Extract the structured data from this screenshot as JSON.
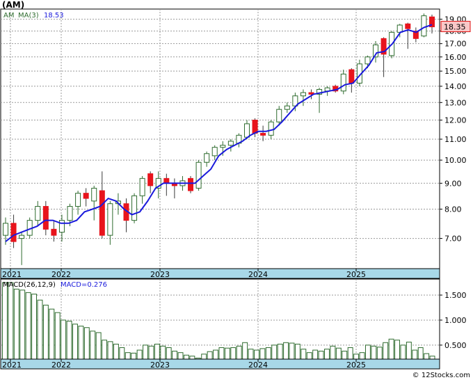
{
  "title": "(AM)",
  "price_legend": {
    "ma_label": "MA(3)",
    "ma_value": "18.53",
    "symbol": "AM"
  },
  "current_price_label": "18.35",
  "macd_legend": {
    "params": "MACD(26,12,9)",
    "value_label": "MACD=0.276"
  },
  "watermark": "© 12Stocks.com",
  "colors": {
    "up_candle": "#2e6b2e",
    "down_candle": "#e8141c",
    "ma_line": "#1a1adc",
    "macd_bar": "#2e6b2e",
    "axis_band": "#a8d8e8",
    "price_tag_bg": "#f9c8c8",
    "price_tag_text": "#e01010"
  },
  "chart_data": [
    {
      "type": "candlestick",
      "title": "(AM)",
      "x_tick_labels": [
        "2021",
        "2022",
        "2023",
        "2024",
        "2025"
      ],
      "y_tick_labels": [
        "7.00",
        "8.00",
        "9.00",
        "10.00",
        "11.00",
        "12.00",
        "13.00",
        "14.00",
        "15.00",
        "16.00",
        "17.00",
        "18.00",
        "19.00"
      ],
      "ylim": [
        6.1,
        19.9
      ],
      "y_scale": "log",
      "grid": true,
      "series": [
        {
          "name": "AM",
          "ohlc": [
            [
              7.1,
              7.7,
              6.8,
              7.5
            ],
            [
              7.5,
              7.8,
              6.7,
              6.9
            ],
            [
              7.0,
              7.2,
              6.2,
              7.1
            ],
            [
              7.1,
              7.7,
              7.0,
              7.6
            ],
            [
              7.6,
              8.3,
              7.4,
              8.1
            ],
            [
              8.1,
              8.3,
              7.1,
              7.3
            ],
            [
              7.3,
              7.6,
              6.9,
              7.1
            ],
            [
              7.2,
              7.8,
              6.9,
              7.6
            ],
            [
              7.6,
              8.2,
              7.4,
              8.1
            ],
            [
              8.1,
              8.7,
              7.8,
              8.6
            ],
            [
              8.6,
              8.8,
              8.1,
              8.4
            ],
            [
              8.3,
              8.9,
              7.6,
              8.8
            ],
            [
              8.7,
              9.5,
              7.0,
              7.1
            ],
            [
              7.1,
              8.3,
              6.8,
              8.2
            ],
            [
              8.2,
              8.6,
              7.8,
              8.3
            ],
            [
              8.2,
              8.4,
              7.2,
              7.6
            ],
            [
              7.6,
              8.6,
              7.5,
              8.5
            ],
            [
              8.5,
              9.3,
              8.2,
              9.2
            ],
            [
              9.4,
              9.5,
              8.6,
              8.9
            ],
            [
              8.8,
              9.5,
              8.4,
              9.2
            ],
            [
              9.2,
              9.4,
              8.5,
              9.0
            ],
            [
              9.0,
              9.2,
              8.4,
              8.9
            ],
            [
              8.9,
              9.3,
              8.7,
              9.1
            ],
            [
              9.2,
              9.3,
              8.6,
              8.7
            ],
            [
              8.8,
              10.0,
              8.7,
              9.9
            ],
            [
              9.9,
              10.4,
              9.7,
              10.3
            ],
            [
              10.2,
              10.7,
              10.0,
              10.6
            ],
            [
              10.6,
              10.9,
              10.2,
              10.7
            ],
            [
              10.7,
              11.0,
              10.4,
              10.9
            ],
            [
              10.8,
              11.3,
              10.6,
              11.2
            ],
            [
              11.1,
              12.0,
              11.0,
              11.8
            ],
            [
              12.0,
              12.1,
              11.1,
              11.3
            ],
            [
              11.3,
              11.7,
              10.9,
              11.2
            ],
            [
              11.2,
              12.0,
              11.0,
              11.9
            ],
            [
              11.9,
              12.8,
              11.7,
              12.6
            ],
            [
              12.6,
              13.0,
              12.4,
              12.8
            ],
            [
              12.8,
              13.6,
              12.5,
              13.4
            ],
            [
              13.4,
              13.8,
              12.8,
              13.6
            ],
            [
              13.6,
              13.8,
              13.2,
              13.5
            ],
            [
              13.5,
              13.9,
              12.4,
              13.8
            ],
            [
              13.7,
              14.0,
              13.4,
              13.9
            ],
            [
              14.0,
              14.1,
              13.6,
              13.7
            ],
            [
              13.7,
              15.1,
              13.5,
              14.8
            ],
            [
              15.1,
              15.2,
              13.6,
              14.2
            ],
            [
              14.2,
              15.8,
              14.0,
              15.5
            ],
            [
              15.5,
              16.1,
              15.2,
              16.0
            ],
            [
              16.0,
              17.2,
              15.6,
              16.9
            ],
            [
              17.4,
              17.5,
              14.6,
              16.2
            ],
            [
              16.1,
              18.0,
              15.9,
              17.9
            ],
            [
              17.9,
              18.6,
              17.5,
              18.5
            ],
            [
              18.6,
              18.7,
              16.6,
              18.2
            ],
            [
              18.0,
              18.3,
              17.1,
              17.4
            ],
            [
              17.6,
              19.5,
              17.5,
              19.3
            ],
            [
              19.2,
              19.4,
              17.8,
              18.35
            ]
          ],
          "ma3": [
            6.9,
            7.1,
            7.2,
            7.3,
            7.4,
            7.6,
            7.6,
            7.5,
            7.5,
            7.6,
            7.9,
            8.0,
            8.1,
            8.4,
            8.3,
            8.0,
            7.8,
            7.9,
            8.3,
            8.8,
            9.0,
            9.0,
            9.0,
            9.0,
            9.0,
            9.3,
            9.6,
            10.2,
            10.5,
            10.7,
            10.9,
            11.2,
            11.4,
            11.4,
            11.5,
            11.9,
            12.4,
            12.9,
            13.2,
            13.5,
            13.6,
            13.7,
            13.8,
            14.1,
            14.2,
            14.8,
            15.4,
            16.3,
            16.4,
            17.0,
            17.9,
            18.1,
            17.9,
            18.3,
            18.53
          ]
        }
      ]
    },
    {
      "type": "bar",
      "title": "MACD(26,12,9)",
      "x_tick_labels": [
        "2021",
        "2022",
        "2023",
        "2024",
        "2025"
      ],
      "y_tick_labels": [
        "0.500",
        "1.000",
        "1.500"
      ],
      "ylim": [
        0.22,
        1.82
      ],
      "series": [
        {
          "name": "MACD",
          "values": [
            1.75,
            1.75,
            1.62,
            1.6,
            1.55,
            1.52,
            1.4,
            1.3,
            1.22,
            1.15,
            1.0,
            0.98,
            0.92,
            0.88,
            0.85,
            0.78,
            0.75,
            0.6,
            0.57,
            0.52,
            0.45,
            0.35,
            0.34,
            0.4,
            0.5,
            0.48,
            0.52,
            0.48,
            0.45,
            0.38,
            0.35,
            0.3,
            0.28,
            0.24,
            0.32,
            0.37,
            0.4,
            0.45,
            0.44,
            0.45,
            0.48,
            0.55,
            0.42,
            0.4,
            0.43,
            0.45,
            0.5,
            0.52,
            0.55,
            0.54,
            0.52,
            0.42,
            0.35,
            0.4,
            0.38,
            0.42,
            0.48,
            0.44,
            0.38,
            0.45,
            0.32,
            0.35,
            0.5,
            0.48,
            0.46,
            0.55,
            0.62,
            0.6,
            0.5,
            0.56,
            0.4,
            0.45,
            0.33,
            0.28
          ]
        }
      ]
    }
  ]
}
